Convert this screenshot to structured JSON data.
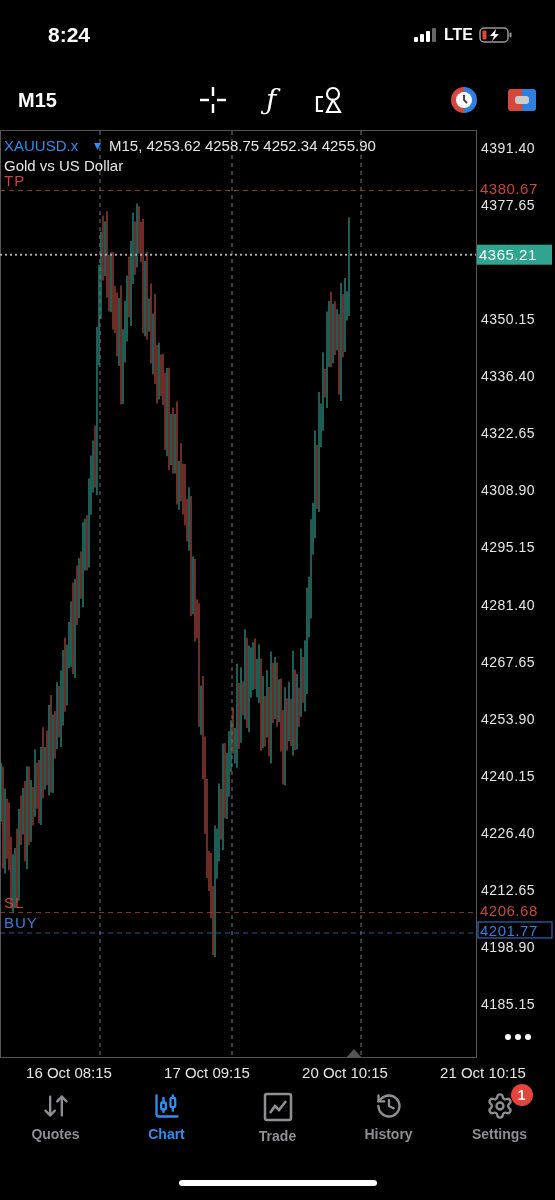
{
  "status_bar": {
    "time": "8:24",
    "network": "LTE"
  },
  "toolbar": {
    "timeframe": "M15",
    "function_symbol": "ƒ"
  },
  "chart": {
    "symbol": "XAUUSD.x",
    "quote": "M15, 4253.62 4258.75 4252.34 4255.90",
    "description": "Gold vs US Dollar",
    "price_labels": [
      "4391.40",
      "4377.65",
      "4350.15",
      "4336.40",
      "4322.65",
      "4308.90",
      "4295.15",
      "4281.40",
      "4267.65",
      "4253.90",
      "4240.15",
      "4226.40",
      "4212.65",
      "4198.90",
      "4185.15"
    ],
    "order_lines": [
      {
        "kind": "tp",
        "label": "TP",
        "price": "4380.67",
        "color": "#c9443e"
      },
      {
        "kind": "sl",
        "label": "SL",
        "price": "4206.68",
        "color": "#c9443e"
      },
      {
        "kind": "buy",
        "label": "BUY",
        "price": "4201.77",
        "color": "#2f7fe0"
      }
    ],
    "current_price": "4365.21",
    "time_labels": [
      "16 Oct 08:15",
      "17 Oct 09:15",
      "20 Oct 10:15",
      "21 Oct 10:15"
    ]
  },
  "tabs": [
    {
      "kind": "quotes",
      "label": "Quotes",
      "selected": false
    },
    {
      "kind": "chart",
      "label": "Chart",
      "selected": true
    },
    {
      "kind": "trade",
      "label": "Trade",
      "selected": false
    },
    {
      "kind": "history",
      "label": "History",
      "selected": false
    },
    {
      "kind": "settings",
      "label": "Settings",
      "selected": false,
      "badge": "1"
    }
  ]
}
